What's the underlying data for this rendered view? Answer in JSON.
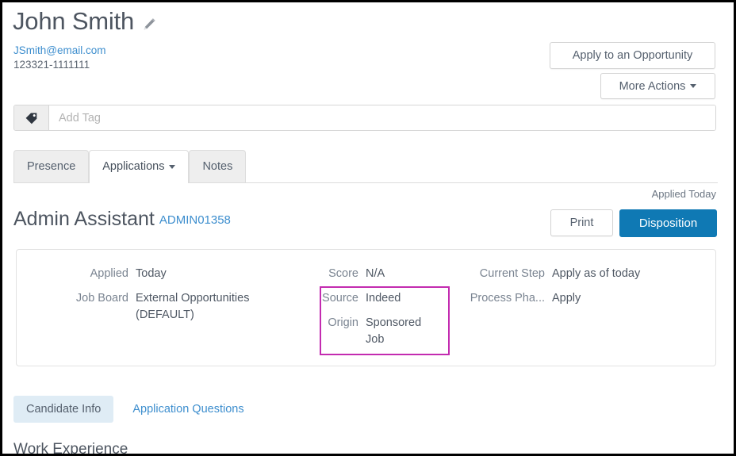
{
  "candidate": {
    "name": "John Smith",
    "edit_icon": "pencil-icon",
    "email": "JSmith@email.com",
    "phone": "123321-1111111"
  },
  "header_actions": {
    "apply_opportunity_label": "Apply to an Opportunity",
    "more_actions_label": "More Actions"
  },
  "tag_bar": {
    "icon": "tag-icon",
    "placeholder": "Add Tag",
    "value": ""
  },
  "tabs": [
    {
      "label": "Presence",
      "active": false,
      "has_caret": false
    },
    {
      "label": "Applications",
      "active": true,
      "has_caret": true
    },
    {
      "label": "Notes",
      "active": false,
      "has_caret": false
    }
  ],
  "application": {
    "applied_status": "Applied Today",
    "job_title": "Admin Assistant",
    "requisition_id": "ADMIN01358",
    "print_label": "Print",
    "disposition_label": "Disposition"
  },
  "details": {
    "column_1": [
      {
        "label": "Applied",
        "value": "Today"
      },
      {
        "label": "Job Board",
        "value": "External Opportunities (DEFAULT)"
      }
    ],
    "column_2": [
      {
        "label": "Score",
        "value": "N/A"
      },
      {
        "label": "Source",
        "value": "Indeed"
      },
      {
        "label": "Origin",
        "value": "Sponsored Job"
      }
    ],
    "column_3": [
      {
        "label": "Current Step",
        "value": "Apply as of today"
      },
      {
        "label": "Process Pha...",
        "value": "Apply"
      }
    ]
  },
  "highlight": {
    "color": "#c32bb0",
    "targets": [
      "Source",
      "Origin"
    ]
  },
  "subtabs": [
    {
      "label": "Candidate Info",
      "active": true
    },
    {
      "label": "Application Questions",
      "active": false
    }
  ],
  "section_heading": "Work Experience",
  "colors": {
    "link": "#3d8ece",
    "primary_button": "#0f79b4",
    "highlight": "#c32bb0",
    "text": "#4f5864",
    "muted_text": "#7a8491"
  }
}
